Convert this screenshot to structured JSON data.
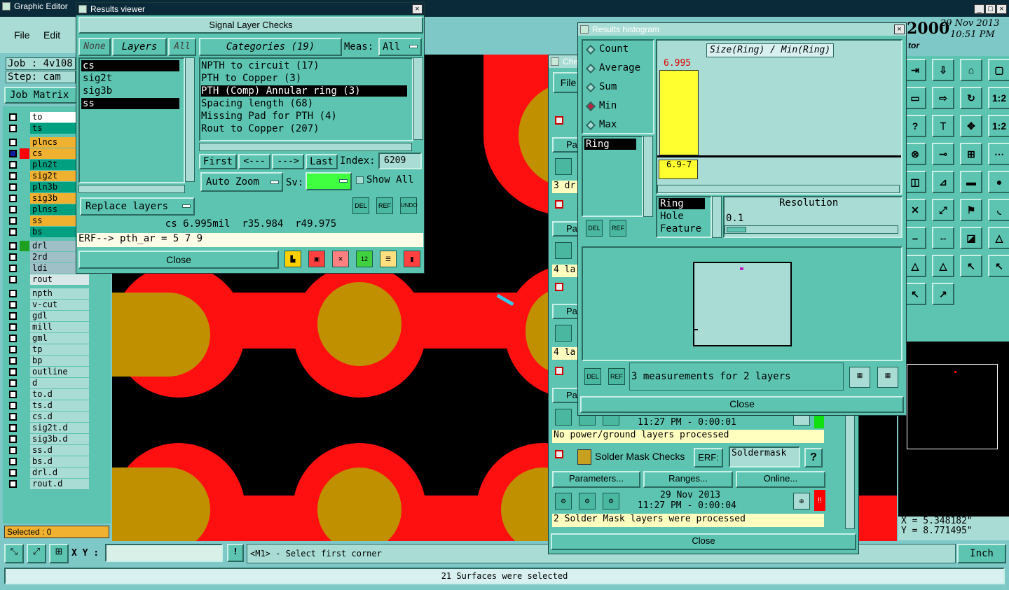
{
  "graphic_editor": {
    "title": "Graphic Editor",
    "menu_file": "File",
    "menu_edit": "Edit",
    "job_label": "Job : 4v108",
    "step_label": "Step: cam",
    "job_matrix": "Job Matrix",
    "selected": "Selected : 0",
    "date_big": "2000",
    "date": "29 Nov 2013",
    "time": "10:51 PM",
    "tor": "tor",
    "coord_x": "X = 5.348182\"",
    "coord_y": "Y = 8.771495\"",
    "xy_label": "X Y :",
    "xy_value": "",
    "status_prompt": "<M1> - Select first corner",
    "status_bar": "21 Surfaces were selected",
    "units": "Inch"
  },
  "layers": [
    {
      "name": "to",
      "color": "#ffffff"
    },
    {
      "name": "ts",
      "color": "#00a080"
    },
    {
      "name": "plncs",
      "color": "#f0b030"
    },
    {
      "name": "cs",
      "color": "#f0b030"
    },
    {
      "name": "pln2t",
      "color": "#00a080"
    },
    {
      "name": "sig2t",
      "color": "#f0b030"
    },
    {
      "name": "pln3b",
      "color": "#00a080"
    },
    {
      "name": "sig3b",
      "color": "#f0b030"
    },
    {
      "name": "plnss",
      "color": "#00a080"
    },
    {
      "name": "ss",
      "color": "#f0b030"
    },
    {
      "name": "bs",
      "color": "#00a080"
    },
    {
      "name": "drl",
      "color": "#a0c0c8"
    },
    {
      "name": "2rd",
      "color": "#a0c0c8"
    },
    {
      "name": "ldi",
      "color": "#a0c0c8"
    },
    {
      "name": "rout",
      "color": "#d8e8e8"
    },
    {
      "name": "npth",
      "color": "#a8dcd4"
    },
    {
      "name": "v-cut",
      "color": "#a8dcd4"
    },
    {
      "name": "gdl",
      "color": "#a8dcd4"
    },
    {
      "name": "mill",
      "color": "#a8dcd4"
    },
    {
      "name": "gml",
      "color": "#a8dcd4"
    },
    {
      "name": "tp",
      "color": "#a8dcd4"
    },
    {
      "name": "bp",
      "color": "#a8dcd4"
    },
    {
      "name": "outline",
      "color": "#a8dcd4"
    },
    {
      "name": "d",
      "color": "#a8dcd4"
    },
    {
      "name": "to.d",
      "color": "#a8dcd4"
    },
    {
      "name": "ts.d",
      "color": "#a8dcd4"
    },
    {
      "name": "cs.d",
      "color": "#a8dcd4"
    },
    {
      "name": "sig2t.d",
      "color": "#a8dcd4"
    },
    {
      "name": "sig3b.d",
      "color": "#a8dcd4"
    },
    {
      "name": "ss.d",
      "color": "#a8dcd4"
    },
    {
      "name": "bs.d",
      "color": "#a8dcd4"
    },
    {
      "name": "drl.d",
      "color": "#a8dcd4"
    },
    {
      "name": "rout.d",
      "color": "#a8dcd4"
    }
  ],
  "results_viewer": {
    "title": "Results viewer",
    "heading": "Signal Layer Checks",
    "none_btn": "None",
    "layers_btn": "Layers",
    "all_btn": "All",
    "categories_label": "Categories (19)",
    "meas_label": "Meas:",
    "meas_value": "All",
    "layer_list": [
      "cs",
      "sig2t",
      "sig3b",
      "ss"
    ],
    "categories": [
      "NPTH to circuit (17)",
      "PTH to Copper (3)",
      "PTH (Comp) Annular ring (3)",
      "Spacing length (68)",
      "Missing Pad for PTH (4)",
      "Rout to Copper (207)"
    ],
    "first_btn": "First",
    "prev_btn": "<---",
    "next_btn": "--->",
    "last_btn": "Last",
    "index_label": "Index:",
    "index_value": "6209",
    "auto_zoom": "Auto Zoom",
    "sv_label": "Sv:",
    "show_all": "Show All",
    "replace_layers": "Replace layers",
    "del": "DEL",
    "ref": "REF",
    "undo": "UNDO",
    "info": "cs 6.995mil  r35.984  r49.975",
    "erf": "ERF--> pth_ar = 5 7 9",
    "close": "Close"
  },
  "results_histogram": {
    "title": "Results histogram",
    "stats": [
      "Count",
      "Average",
      "Sum",
      "Min",
      "Max"
    ],
    "selected_stat": "Min",
    "plot_title": "Size(Ring) / Min(Ring)",
    "bar_value_label": "6.995",
    "bar_value": 6.995,
    "axis_label": "6.9-7",
    "attributes": [
      "Ring"
    ],
    "modes": [
      "Ring",
      "Hole",
      "Feature"
    ],
    "resolution_label": "Resolution",
    "resolution_value": "0.1",
    "summary": "3 measurements for 2 layers",
    "close": "Close",
    "del": "DEL",
    "ref": "REF"
  },
  "checklist": {
    "title": "Che",
    "file": "File",
    "pa": "Pa",
    "rows": [
      "3 dr",
      "4 la",
      "4 la"
    ],
    "time1": "11:27 PM - 0:00:01",
    "msg1": "No power/ground layers processed",
    "solder_title": "Solder Mask Checks",
    "erf": "ERF:",
    "erf_value": "Soldermask",
    "help": "?",
    "params": "Parameters...",
    "ranges": "Ranges...",
    "online": "Online...",
    "date2": "29 Nov 2013",
    "time2": "11:27 PM - 0:00:04",
    "msg2": "2 Solder Mask layers were processed",
    "close": "Close",
    "warn": "!!"
  },
  "toolbar_icons": [
    "align",
    "export",
    "home",
    "window",
    "frame",
    "move",
    "rotate",
    "ratio",
    "help",
    "step",
    "center",
    "1:2",
    "query",
    "pin",
    "route",
    "plug",
    "net",
    "draw",
    "ruler",
    "circle",
    "cross",
    "split",
    "flag",
    "arc",
    "dash",
    "dim",
    "box",
    "tri",
    "tri2",
    "tri3",
    "ptr",
    "ptr2",
    "ptr3",
    "edit"
  ]
}
